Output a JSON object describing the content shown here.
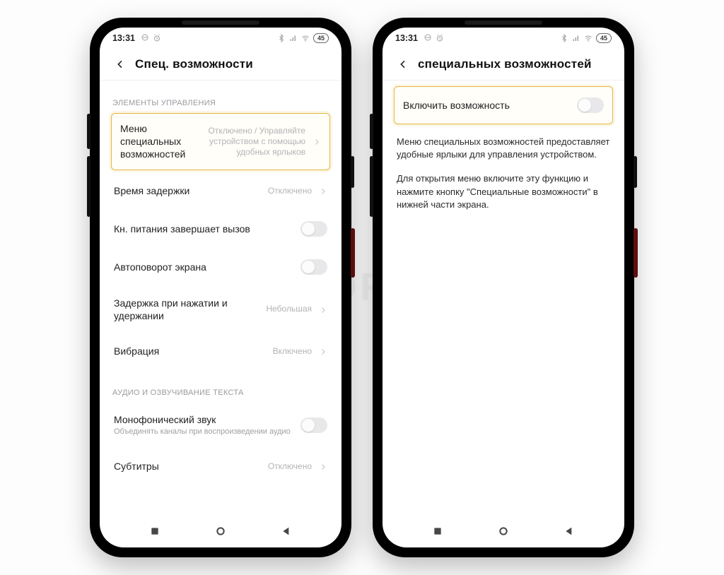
{
  "watermark": "SIBDROID",
  "status": {
    "time": "13:31",
    "battery": "45"
  },
  "left": {
    "header_title": "Спец. возможности",
    "section1_label": "ЭЛЕМЕНТЫ УПРАВЛЕНИЯ",
    "row_menu": {
      "title": "Меню специальных возможностей",
      "value": "Отключено / Управляйте устройством с помощью удобных ярлыков"
    },
    "row_delay": {
      "title": "Время задержки",
      "value": "Отключено"
    },
    "row_power": {
      "title": "Кн. питания завершает вызов"
    },
    "row_rotate": {
      "title": "Автоповорот экрана"
    },
    "row_hold": {
      "title": "Задержка при нажатии и удержании",
      "value": "Небольшая"
    },
    "row_vibro": {
      "title": "Вибрация",
      "value": "Включено"
    },
    "section2_label": "АУДИО И ОЗВУЧИВАНИЕ ТЕКСТА",
    "row_mono": {
      "title": "Монофонический звук",
      "sub": "Объединять каналы при воспроизведении аудио"
    },
    "row_subs": {
      "title": "Субтитры",
      "value": "Отключено"
    }
  },
  "right": {
    "header_title": "специальных возможностей",
    "row_enable": {
      "title": "Включить возможность"
    },
    "para1": "Меню специальных возможностей предоставляет удобные ярлыки для управления устройством.",
    "para2": "Для открытия меню включите эту функцию и нажмите кнопку \"Специальные возможности\" в нижней части экрана."
  }
}
